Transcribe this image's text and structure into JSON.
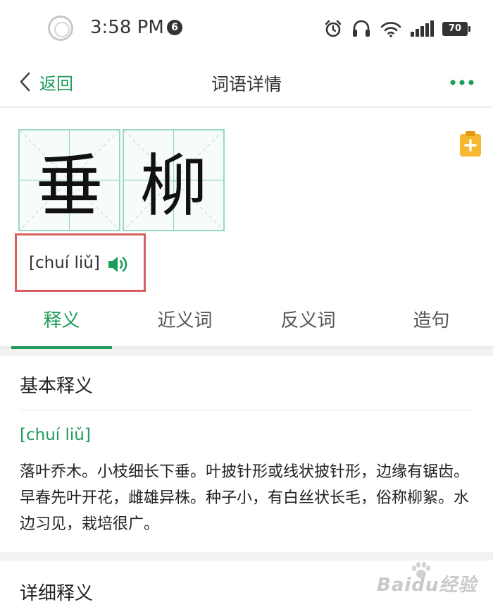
{
  "status_bar": {
    "time": "3:58 PM",
    "notification_count": "6",
    "battery_level": "70",
    "icons": [
      "alarm-icon",
      "headset-icon",
      "wifi-icon",
      "signal-icon",
      "battery-icon"
    ]
  },
  "nav": {
    "back_label": "返回",
    "title": "词语详情",
    "icons": [
      "chevron-left-icon",
      "more-dots-icon"
    ]
  },
  "word": {
    "characters": [
      "垂",
      "柳"
    ],
    "pinyin": "[chuí liǔ]",
    "icons": [
      "speaker-icon",
      "add-note-icon"
    ]
  },
  "tabs": [
    {
      "label": "释义",
      "active": true
    },
    {
      "label": "近义词",
      "active": false
    },
    {
      "label": "反义词",
      "active": false
    },
    {
      "label": "造句",
      "active": false
    }
  ],
  "basic": {
    "title": "基本释义",
    "pinyin": "[chuí liǔ]",
    "definition": "落叶乔木。小枝细长下垂。叶披针形或线状披针形，边缘有锯齿。早春先叶开花，雌雄异株。种子小，有白丝状长毛，俗称柳絮。水边习见，栽培很广。"
  },
  "detail": {
    "title": "详细释义"
  },
  "watermark": {
    "text": "Baidu经验"
  },
  "colors": {
    "accent": "#1e9c5a",
    "highlight_box": "#d85f5f",
    "grid_line": "#9bd7c8",
    "badge": "#f7b731"
  }
}
